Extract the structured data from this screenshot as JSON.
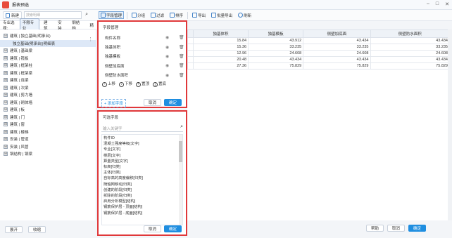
{
  "window": {
    "title": "报表预选"
  },
  "left_toolbar": {
    "new_label": "新建",
    "search_placeholder": "搜索明细"
  },
  "tabs": {
    "prefix": "专业选择:",
    "items": [
      "不限专业",
      "建筑",
      "安装",
      "钢结构",
      "精"
    ]
  },
  "tree": [
    {
      "label": "建筑 | 独立基础(明承台)",
      "expand": "⊟"
    },
    {
      "label": "独立基础(明承台)|明细表",
      "child": true
    },
    {
      "label": "建筑 | 基础梁",
      "expand": "⊞"
    },
    {
      "label": "建筑 | 筏板",
      "expand": "⊞"
    },
    {
      "label": "建筑 | 框架柱",
      "expand": "⊞"
    },
    {
      "label": "建筑 | 框架梁",
      "expand": "⊞"
    },
    {
      "label": "建筑 | 连梁",
      "expand": "⊞"
    },
    {
      "label": "建筑 | 次梁",
      "expand": "⊞"
    },
    {
      "label": "建筑 | 剪力墙",
      "expand": "⊞"
    },
    {
      "label": "建筑 | 砌体墙",
      "expand": "⊞"
    },
    {
      "label": "建筑 | 板",
      "expand": "⊞"
    },
    {
      "label": "建筑 | 门",
      "expand": "⊞"
    },
    {
      "label": "建筑 | 窗",
      "expand": "⊞"
    },
    {
      "label": "建筑 | 楼梯",
      "expand": "⊞"
    },
    {
      "label": "安装 | 管道",
      "expand": "⊞"
    },
    {
      "label": "安装 | 风管",
      "expand": "⊞"
    },
    {
      "label": "钢结构 | 钢梁",
      "expand": "⊞"
    }
  ],
  "bottom_left": {
    "expand_label": "展开",
    "collapse_label": "收缩"
  },
  "right_toolbar": [
    "字段管理",
    "分组",
    "过滤",
    "排序",
    "导出",
    "批量导出",
    "刷新"
  ],
  "grid": {
    "headers": [
      "",
      "独基体积",
      "独基模板",
      "侧壁加底面",
      "侧壁防水面积"
    ],
    "rows": [
      [
        "",
        "15.84",
        "43.912",
        "43.434",
        "43.434"
      ],
      [
        "",
        "15.36",
        "33.235",
        "33.235",
        "33.235"
      ],
      [
        "",
        "12.96",
        "24.608",
        "24.608",
        "24.608"
      ],
      [
        "",
        "20.48",
        "43.434",
        "43.434",
        "43.434"
      ],
      [
        "",
        "27.36",
        "75.829",
        "75.829",
        "75.829"
      ]
    ]
  },
  "bottom_right": {
    "help_label": "帮助",
    "cancel_label": "取消",
    "ok_label": "确定"
  },
  "field_panel": {
    "title": "字段管理",
    "fields": [
      "构件名称",
      "独基体积",
      "独基模板",
      "侧壁加底面",
      "侧壁防水面积"
    ],
    "actions": [
      "上移",
      "下移",
      "置顶",
      "置底"
    ],
    "add_label": "+ 添加字段",
    "cancel_label": "取消",
    "ok_label": "确定"
  },
  "optional_panel": {
    "title": "可选字段",
    "search_placeholder": "输入关键字",
    "items": [
      "构件ID",
      "混凝土强度等级[文字]",
      "专业[文字]",
      "楼层[文字]",
      "算量类型[文字]",
      "标高[归类]",
      "主体[归类]",
      "自标高的高度偏移[归类]",
      "随轴网移动[归类]",
      "创建的阶段[归类]",
      "拆除的阶段[归类]",
      "启用分析模型[结构]",
      "钢筋保护层 - 顶面[结构]",
      "钢筋保护层 - 底面[结构]"
    ],
    "cancel_label": "取消",
    "ok_label": "确定"
  }
}
